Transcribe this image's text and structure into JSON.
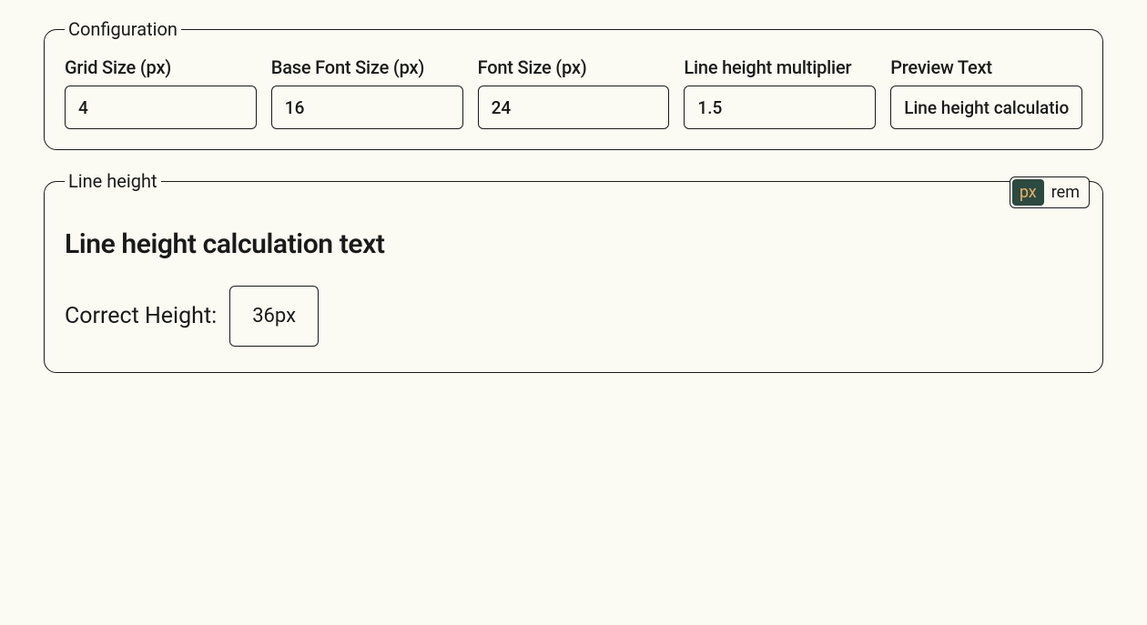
{
  "config": {
    "legend": "Configuration",
    "fields": {
      "gridSize": {
        "label": "Grid Size (px)",
        "value": "4"
      },
      "baseFontSize": {
        "label": "Base Font Size (px)",
        "value": "16"
      },
      "fontSize": {
        "label": "Font Size (px)",
        "value": "24"
      },
      "lineHeightMultiplier": {
        "label": "Line height multiplier",
        "value": "1.5"
      },
      "previewText": {
        "label": "Preview Text",
        "value": "Line height calculation text"
      }
    }
  },
  "lineHeight": {
    "legend": "Line height",
    "unitToggle": {
      "px": "px",
      "rem": "rem",
      "active": "px"
    },
    "previewText": "Line height calculation text",
    "resultLabel": "Correct Height:",
    "resultValue": "36px"
  }
}
